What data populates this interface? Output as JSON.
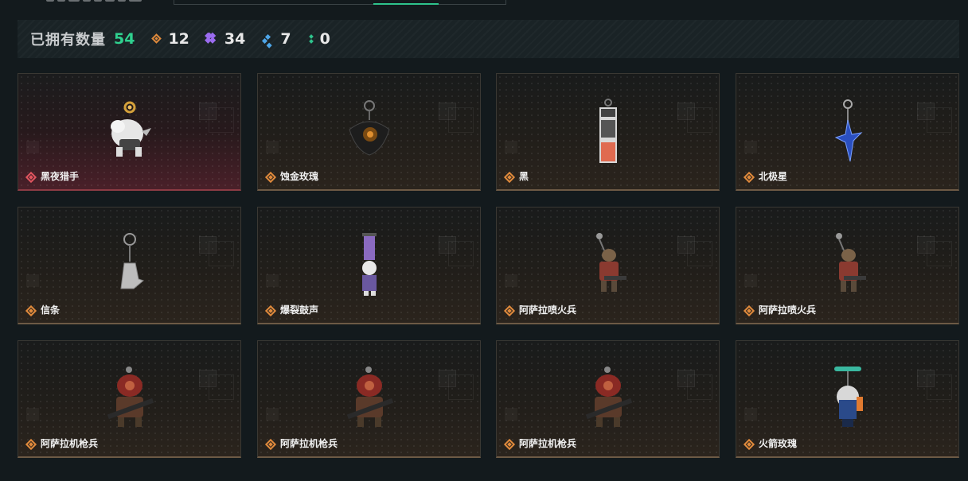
{
  "stats": {
    "owned_label": "已拥有数量",
    "owned_total": "54",
    "counters": [
      {
        "icon": "orange-diamond-icon",
        "value": "12"
      },
      {
        "icon": "purple-diamond-icon",
        "value": "34"
      },
      {
        "icon": "blue-diamond-icon",
        "value": "7"
      },
      {
        "icon": "green-dots-icon",
        "value": "0"
      }
    ]
  },
  "colors": {
    "accent": "#2fd18f",
    "rarity_orange": "#e08a3c",
    "rarity_red": "#e0555f",
    "rarity_purple": "#9b6cf0",
    "rarity_blue": "#4ea6e8",
    "rarity_green": "#2ec38c"
  },
  "items": [
    {
      "name": "黑夜猎手",
      "rarity": "red",
      "art": "white-beast-charm"
    },
    {
      "name": "蚀金玫瑰",
      "rarity": "orange",
      "art": "black-rose-charm"
    },
    {
      "name": "黑",
      "rarity": "orange",
      "art": "card-tag-charm"
    },
    {
      "name": "北极星",
      "rarity": "orange",
      "art": "blue-star-charm"
    },
    {
      "name": "信条",
      "rarity": "orange",
      "art": "silver-hand-charm"
    },
    {
      "name": "爆裂鼓声",
      "rarity": "orange",
      "art": "drum-figure-charm"
    },
    {
      "name": "阿萨拉喷火兵",
      "rarity": "orange",
      "art": "flamethrower-soldier-charm"
    },
    {
      "name": "阿萨拉喷火兵",
      "rarity": "orange",
      "art": "flamethrower-soldier-charm"
    },
    {
      "name": "阿萨拉机枪兵",
      "rarity": "orange",
      "art": "machinegunner-charm"
    },
    {
      "name": "阿萨拉机枪兵",
      "rarity": "orange",
      "art": "machinegunner-charm"
    },
    {
      "name": "阿萨拉机枪兵",
      "rarity": "orange",
      "art": "machinegunner-charm"
    },
    {
      "name": "火箭玫瑰",
      "rarity": "orange",
      "art": "rocket-rose-charm"
    }
  ]
}
